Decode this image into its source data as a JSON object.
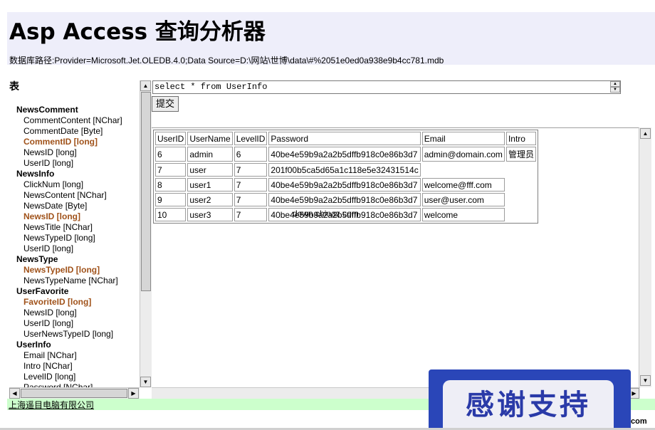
{
  "header": {
    "title": "Asp Access 查询分析器",
    "db_path": "数据库路径:Provider=Microsoft.Jet.OLEDB.4.0;Data Source=D:\\网站\\世博\\data\\#%2051e0ed0a938e9b4cc781.mdb"
  },
  "tree": {
    "heading": "表",
    "items": [
      {
        "text": "NewsComment",
        "kind": "table"
      },
      {
        "text": "CommentContent [NChar]",
        "kind": "field"
      },
      {
        "text": "CommentDate [Byte]",
        "kind": "field"
      },
      {
        "text": "CommentID [long]",
        "kind": "pk"
      },
      {
        "text": "NewsID [long]",
        "kind": "field"
      },
      {
        "text": "UserID [long]",
        "kind": "field"
      },
      {
        "text": "NewsInfo",
        "kind": "table"
      },
      {
        "text": "ClickNum [long]",
        "kind": "field"
      },
      {
        "text": "NewsContent [NChar]",
        "kind": "field"
      },
      {
        "text": "NewsDate [Byte]",
        "kind": "field"
      },
      {
        "text": "NewsID [long]",
        "kind": "pk"
      },
      {
        "text": "NewsTitle [NChar]",
        "kind": "field"
      },
      {
        "text": "NewsTypeID [long]",
        "kind": "field"
      },
      {
        "text": "UserID [long]",
        "kind": "field"
      },
      {
        "text": "NewsType",
        "kind": "table"
      },
      {
        "text": "NewsTypeID [long]",
        "kind": "pk"
      },
      {
        "text": "NewsTypeName [NChar]",
        "kind": "field"
      },
      {
        "text": "UserFavorite",
        "kind": "table"
      },
      {
        "text": "FavoriteID [long]",
        "kind": "pk"
      },
      {
        "text": "NewsID [long]",
        "kind": "field"
      },
      {
        "text": "UserID [long]",
        "kind": "field"
      },
      {
        "text": "UserNewsTypeID [long]",
        "kind": "field"
      },
      {
        "text": "UserInfo",
        "kind": "table"
      },
      {
        "text": "Email [NChar]",
        "kind": "field"
      },
      {
        "text": "Intro [NChar]",
        "kind": "field"
      },
      {
        "text": "LevelID [long]",
        "kind": "field"
      },
      {
        "text": "Password [NChar]",
        "kind": "field"
      }
    ]
  },
  "query": {
    "sql": "select * from UserInfo",
    "submit_label": "提交"
  },
  "results": {
    "columns": [
      "UserID",
      "UserName",
      "LevelID",
      "Password",
      "Email",
      "Intro"
    ],
    "rows": [
      [
        "6",
        "admin",
        "6",
        "40be4e59b9a2a2b5dffb918c0e86b3d7",
        "admin@domain.com",
        "管理员"
      ],
      [
        "7",
        "user",
        "7",
        "201f00b5ca5d65a1c118e5e32431514c",
        "",
        ""
      ],
      [
        "8",
        "user1",
        "7",
        "40be4e59b9a2a2b5dffb918c0e86b3d7",
        "welcome@fff.com",
        ""
      ],
      [
        "9",
        "user2",
        "7",
        "40be4e59b9a2a2b5dffb918c0e86b3d7",
        "user@user.com",
        ""
      ],
      [
        "10",
        "user3",
        "7",
        "40be4e59b9a2a2b5dffb918c0e86b3d7",
        "welcome",
        ""
      ]
    ]
  },
  "watermark": "down.chinaz.com",
  "footer": {
    "company": "上海遥目电脑有限公司",
    "banner_text": "感谢支持",
    "com_text": "com"
  },
  "colors": {
    "header_bg": "#eeeefa",
    "pk_field": "#a0521a",
    "footer_bg": "#ccffcc",
    "banner_blue": "#2a46b8"
  }
}
